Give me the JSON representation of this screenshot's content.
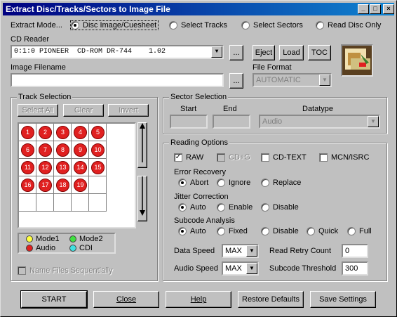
{
  "window": {
    "title": "Extract Disc/Tracks/Sectors to Image File"
  },
  "colors": {
    "titlebar": "#000080",
    "track_red": "#e02020",
    "mode1": "#ffff40",
    "mode2": "#40e040",
    "audio": "#e02020",
    "cdi": "#40e0e0"
  },
  "extract_mode": {
    "label": "Extract Mode...",
    "options": [
      "Disc Image/Cuesheet",
      "Select Tracks",
      "Select Sectors",
      "Read Disc Only"
    ],
    "selected": "Disc Image/Cuesheet"
  },
  "cd_reader": {
    "label": "CD Reader",
    "value": "0:1:0 PIONEER  CD-ROM DR-744    1.02",
    "browse": "...",
    "eject": "Eject",
    "load": "Load",
    "toc": "TOC"
  },
  "image_filename": {
    "label": "Image Filename",
    "value": "",
    "browse": "..."
  },
  "file_format": {
    "label": "File Format",
    "value": "AUTOMATIC"
  },
  "track_selection": {
    "title": "Track Selection",
    "select_all": "Select All",
    "clear": "Clear",
    "invert": "Invert",
    "tracks": [
      "1",
      "2",
      "3",
      "4",
      "5",
      "6",
      "7",
      "8",
      "9",
      "10",
      "11",
      "12",
      "13",
      "14",
      "15",
      "16",
      "17",
      "18",
      "19"
    ],
    "legend": {
      "mode1": "Mode1",
      "mode2": "Mode2",
      "audio": "Audio",
      "cdi": "CDI"
    },
    "name_files": "Name Files Sequentially"
  },
  "sector_selection": {
    "title": "Sector Selection",
    "start": "Start",
    "end": "End",
    "datatype": "Datatype",
    "datatype_value": "Audio"
  },
  "reading_options": {
    "title": "Reading Options",
    "checks": {
      "raw": "RAW",
      "cdg": "CD+G",
      "cdtext": "CD-TEXT",
      "mcn": "MCN/ISRC"
    },
    "error_recovery": {
      "label": "Error Recovery",
      "options": [
        "Abort",
        "Ignore",
        "Replace"
      ],
      "selected": "Abort"
    },
    "jitter": {
      "label": "Jitter Correction",
      "options": [
        "Auto",
        "Enable",
        "Disable"
      ],
      "selected": "Auto"
    },
    "subcode": {
      "label": "Subcode Analysis",
      "options": [
        "Auto",
        "Fixed",
        "Disable",
        "Quick",
        "Full"
      ],
      "selected": "Auto"
    },
    "data_speed": {
      "label": "Data Speed",
      "value": "MAX"
    },
    "audio_speed": {
      "label": "Audio Speed",
      "value": "MAX"
    },
    "retry": {
      "label": "Read Retry Count",
      "value": "0"
    },
    "threshold": {
      "label": "Subcode Threshold",
      "value": "300"
    }
  },
  "footer": {
    "start": "START",
    "close": "Close",
    "help": "Help",
    "restore": "Restore Defaults",
    "save": "Save Settings"
  }
}
